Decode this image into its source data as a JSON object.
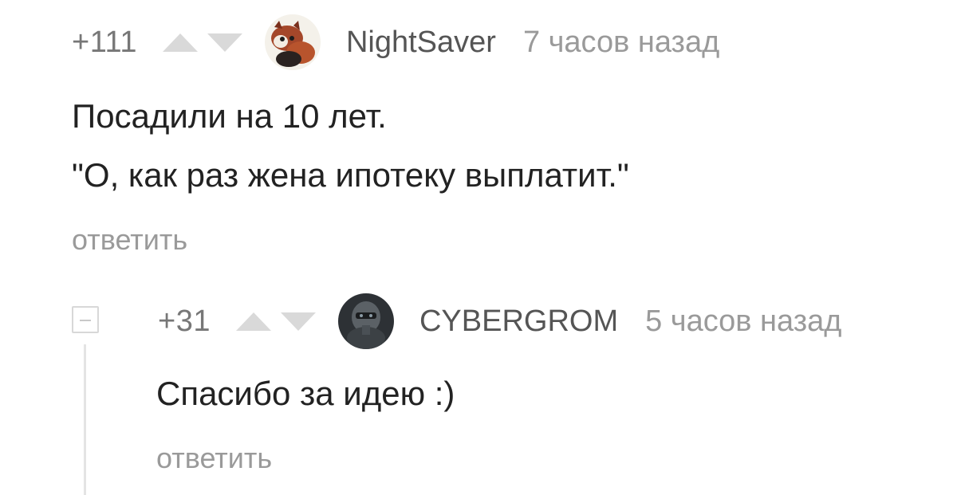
{
  "comments": [
    {
      "rating": "+111",
      "author": "NightSaver",
      "time": "7 часов назад",
      "text": [
        "Посадили на 10 лет.",
        "\"О, как раз жена ипотеку выплатит.\""
      ],
      "reply_label": "ответить",
      "avatar_icon": "red-panda-avatar"
    },
    {
      "rating": "+31",
      "author": "CYBERGROM",
      "time": "5 часов назад",
      "text": [
        "Спасибо за идею :)"
      ],
      "reply_label": "ответить",
      "avatar_icon": "dark-helmet-avatar"
    }
  ],
  "colors": {
    "rating": "#777777",
    "author": "#555555",
    "time": "#9a9a9a",
    "text": "#222222",
    "vote_arrow": "#d9d9d9",
    "thread_line": "#e4e4e4"
  }
}
